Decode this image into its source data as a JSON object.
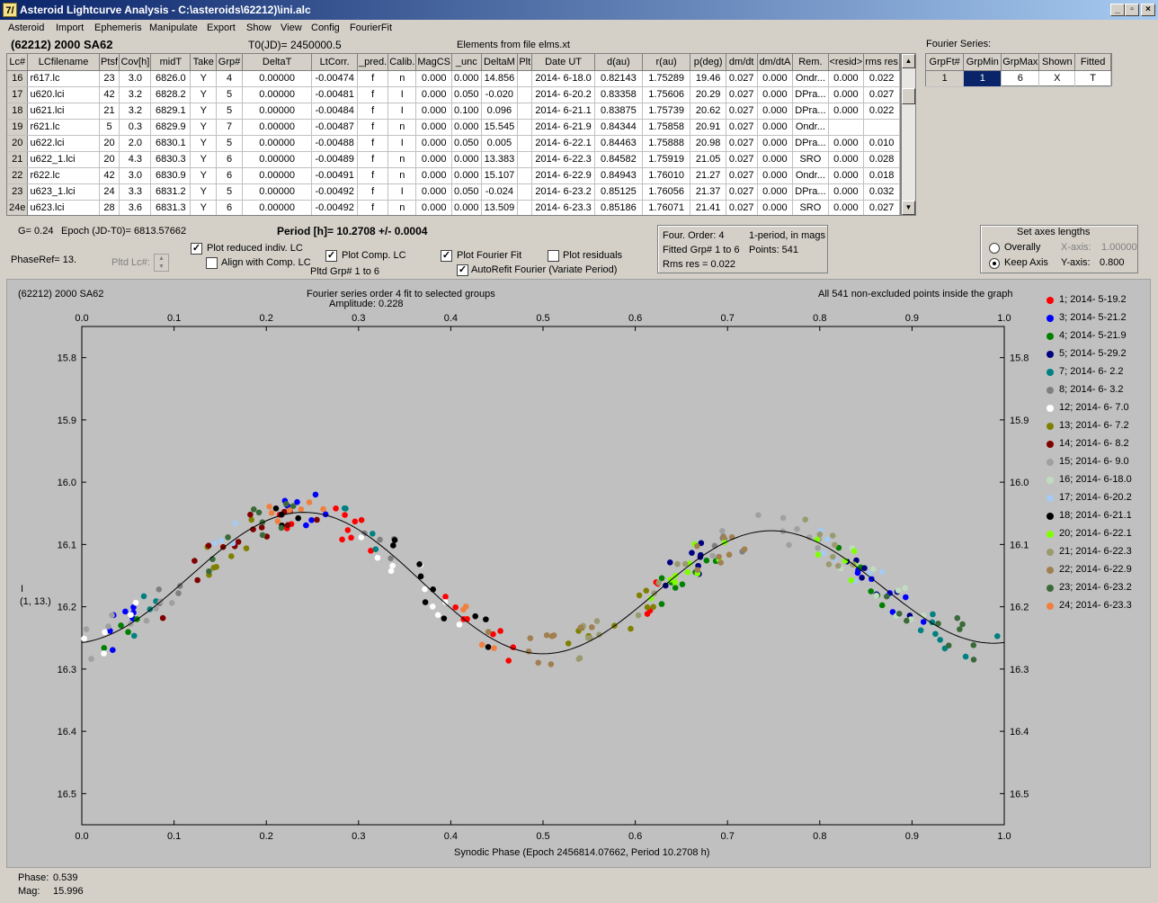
{
  "window": {
    "title": "Asteroid Lightcurve Analysis - C:\\asteroids\\62212)\\ini.alc",
    "icon": "7/",
    "btn_min": "_",
    "btn_max": "▫",
    "btn_close": "×"
  },
  "menu": [
    "Asteroid",
    "Import",
    "Ephemeris",
    "Manipulate",
    "Export",
    "Show",
    "View",
    "Config",
    "FourierFit"
  ],
  "header": {
    "object": "(62212) 2000 SA62",
    "t0": "T0(JD)= 2450000.5",
    "elements": "Elements from file elms.xt",
    "fourier_series_label": "Fourier Series:"
  },
  "lc_table": {
    "columns": [
      "Lc#",
      "LCfilename",
      "Ptsf",
      "Cov[h]",
      "midT",
      "Take",
      "Grp#",
      "DeltaT",
      "LtCorr.",
      "_pred.",
      "Calib.",
      "MagCS",
      "_unc",
      "DeltaM",
      "Plt",
      "Date UT",
      "d(au)",
      "r(au)",
      "p(deg)",
      "dm/dt",
      "dm/dtA",
      "Rem.",
      "<resid>",
      "rms res"
    ],
    "rows": [
      [
        "16",
        "r617.lc",
        "23",
        "3.0",
        "6826.0",
        "Y",
        "4",
        "0.00000",
        "-0.00474",
        "f",
        "n",
        "0.000",
        "0.000",
        "14.856",
        "",
        "2014- 6-18.0",
        "0.82143",
        "1.75289",
        "19.46",
        "0.027",
        "0.000",
        "Ondr...",
        "0.000",
        "0.022"
      ],
      [
        "17",
        "u620.lci",
        "42",
        "3.2",
        "6828.2",
        "Y",
        "5",
        "0.00000",
        "-0.00481",
        "f",
        "I",
        "0.000",
        "0.050",
        "-0.020",
        "",
        "2014- 6-20.2",
        "0.83358",
        "1.75606",
        "20.29",
        "0.027",
        "0.000",
        "DPra...",
        "0.000",
        "0.027"
      ],
      [
        "18",
        "u621.lci",
        "21",
        "3.2",
        "6829.1",
        "Y",
        "5",
        "0.00000",
        "-0.00484",
        "f",
        "I",
        "0.000",
        "0.100",
        "0.096",
        "",
        "2014- 6-21.1",
        "0.83875",
        "1.75739",
        "20.62",
        "0.027",
        "0.000",
        "DPra...",
        "0.000",
        "0.022"
      ],
      [
        "19",
        "r621.lc",
        "5",
        "0.3",
        "6829.9",
        "Y",
        "7",
        "0.00000",
        "-0.00487",
        "f",
        "n",
        "0.000",
        "0.000",
        "15.545",
        "",
        "2014- 6-21.9",
        "0.84344",
        "1.75858",
        "20.91",
        "0.027",
        "0.000",
        "Ondr...",
        "",
        ""
      ],
      [
        "20",
        "u622.lci",
        "20",
        "2.0",
        "6830.1",
        "Y",
        "5",
        "0.00000",
        "-0.00488",
        "f",
        "I",
        "0.000",
        "0.050",
        "0.005",
        "",
        "2014- 6-22.1",
        "0.84463",
        "1.75888",
        "20.98",
        "0.027",
        "0.000",
        "DPra...",
        "0.000",
        "0.010"
      ],
      [
        "21",
        "u622_1.lci",
        "20",
        "4.3",
        "6830.3",
        "Y",
        "6",
        "0.00000",
        "-0.00489",
        "f",
        "n",
        "0.000",
        "0.000",
        "13.383",
        "",
        "2014- 6-22.3",
        "0.84582",
        "1.75919",
        "21.05",
        "0.027",
        "0.000",
        "SRO",
        "0.000",
        "0.028"
      ],
      [
        "22",
        "r622.lc",
        "42",
        "3.0",
        "6830.9",
        "Y",
        "6",
        "0.00000",
        "-0.00491",
        "f",
        "n",
        "0.000",
        "0.000",
        "15.107",
        "",
        "2014- 6-22.9",
        "0.84943",
        "1.76010",
        "21.27",
        "0.027",
        "0.000",
        "Ondr...",
        "0.000",
        "0.018"
      ],
      [
        "23",
        "u623_1.lci",
        "24",
        "3.3",
        "6831.2",
        "Y",
        "5",
        "0.00000",
        "-0.00492",
        "f",
        "I",
        "0.000",
        "0.050",
        "-0.024",
        "",
        "2014- 6-23.2",
        "0.85125",
        "1.76056",
        "21.37",
        "0.027",
        "0.000",
        "DPra...",
        "0.000",
        "0.032"
      ],
      [
        "24e",
        "u623.lci",
        "28",
        "3.6",
        "6831.3",
        "Y",
        "6",
        "0.00000",
        "-0.00492",
        "f",
        "n",
        "0.000",
        "0.000",
        "13.509",
        "",
        "2014- 6-23.3",
        "0.85186",
        "1.76071",
        "21.41",
        "0.027",
        "0.000",
        "SRO",
        "0.000",
        "0.027"
      ]
    ]
  },
  "fourier_table": {
    "columns": [
      "GrpFt#",
      "GrpMin",
      "GrpMax",
      "Shown",
      "Fitted"
    ],
    "row": [
      "1",
      "1",
      "6",
      "X",
      "T"
    ]
  },
  "controls": {
    "g_label": "G= 0.24",
    "epoch_label": "Epoch (JD-T0)= 6813.57662",
    "period_label": "Period [h]= 10.2708 +/- 0.0004",
    "phase_ref": "PhaseRef= 13.",
    "pltd_lc": "Pltd Lc#:",
    "plot_reduced": "Plot reduced indiv. LC",
    "align_comp": "Align with Comp. LC",
    "plot_comp": "Plot Comp. LC",
    "pltd_grp": "Pltd Grp#  1   to   6",
    "plot_fourier": "Plot Fourier Fit",
    "plot_residuals": "Plot residuals",
    "autorefit": "AutoRefit Fourier (Variate Period)",
    "info1": "Four. Order:  4",
    "info2": "1-period, in mags",
    "info3": "Fitted Grp# 1 to 6",
    "info4": "Points: 541",
    "info5": "Rms res     = 0.022",
    "axes_title": "Set axes lengths",
    "overally": "Overally",
    "keep_axis": "Keep Axis",
    "xaxis_label": "X-axis:",
    "xaxis_val": "1.00000",
    "yaxis_label": "Y-axis:",
    "yaxis_val": "0.800"
  },
  "chart_data": {
    "type": "scatter",
    "title": "(62212) 2000 SA62",
    "subtitle": "Fourier series order 4 fit to selected groups",
    "amplitude": "Amplitude: 0.228",
    "note": "All 541 non-excluded points inside the graph",
    "xlabel": "Synodic Phase (Epoch 2456814.07662, Period 10.2708 h)",
    "ylabel": "I",
    "ylabel2": "(1, 13.)",
    "xlim": [
      0,
      1
    ],
    "ylim": [
      16.55,
      15.75
    ],
    "x_ticks": [
      "0.0",
      "0.1",
      "0.2",
      "0.3",
      "0.4",
      "0.5",
      "0.6",
      "0.7",
      "0.8",
      "0.9",
      "1.0"
    ],
    "y_ticks": [
      "15.8",
      "15.9",
      "16.0",
      "16.1",
      "16.2",
      "16.3",
      "16.4",
      "16.5"
    ],
    "grid": false,
    "fourier_fit": {
      "mean": 16.165,
      "terms": [
        [
          -0.009,
          -0.0145
        ],
        [
          0.1015,
          -0.0075
        ],
        [
          0.0,
          0.0
        ],
        [
          0.0,
          0.0
        ]
      ]
    },
    "series": [
      {
        "name": "1; 2014- 5-19.2",
        "color": "#ff0000",
        "ranges": [
          [
            0.2,
            0.33
          ],
          [
            0.38,
            0.47
          ],
          [
            0.6,
            0.63
          ]
        ]
      },
      {
        "name": "3; 2014- 5-21.2",
        "color": "#0000ff",
        "ranges": [
          [
            0.0,
            0.08
          ],
          [
            0.2,
            0.28
          ],
          [
            0.84,
            0.92
          ]
        ]
      },
      {
        "name": "4; 2014- 5-21.9",
        "color": "#008000",
        "ranges": [
          [
            0.01,
            0.06
          ],
          [
            0.62,
            0.72
          ],
          [
            0.82,
            0.88
          ]
        ]
      },
      {
        "name": "5; 2014- 5-29.2",
        "color": "#000080",
        "ranges": [
          [
            0.61,
            0.7
          ],
          [
            0.82,
            0.9
          ]
        ]
      },
      {
        "name": "7; 2014- 6- 2.2",
        "color": "#008080",
        "ranges": [
          [
            0.05,
            0.1
          ],
          [
            0.28,
            0.33
          ],
          [
            0.9,
            1.0
          ]
        ]
      },
      {
        "name": "8; 2014- 6- 3.2",
        "color": "#808080",
        "ranges": [
          [
            0.07,
            0.12
          ],
          [
            0.3,
            0.35
          ],
          [
            0.66,
            0.72
          ]
        ]
      },
      {
        "name": "12; 2014- 6- 7.0",
        "color": "#ffffff",
        "ranges": [
          [
            0.0,
            0.06
          ],
          [
            0.3,
            0.42
          ]
        ]
      },
      {
        "name": "13; 2014- 6- 7.2",
        "color": "#808000",
        "ranges": [
          [
            0.12,
            0.2
          ],
          [
            0.52,
            0.64
          ]
        ]
      },
      {
        "name": "14; 2014- 6- 8.2",
        "color": "#800000",
        "ranges": [
          [
            0.08,
            0.26
          ]
        ]
      },
      {
        "name": "15; 2014- 6- 9.0",
        "color": "#a0a0a0",
        "ranges": [
          [
            0.0,
            0.1
          ],
          [
            0.68,
            0.8
          ]
        ]
      },
      {
        "name": "16; 2014- 6-18.0",
        "color": "#c0dcc0",
        "ranges": [
          [
            0.82,
            0.92
          ]
        ]
      },
      {
        "name": "17; 2014- 6-20.2",
        "color": "#a6caf0",
        "ranges": [
          [
            0.14,
            0.18
          ],
          [
            0.8,
            0.88
          ]
        ]
      },
      {
        "name": "18; 2014- 6-21.1",
        "color": "#000000",
        "ranges": [
          [
            0.21,
            0.24
          ],
          [
            0.33,
            0.45
          ]
        ]
      },
      {
        "name": "20; 2014- 6-22.1",
        "color": "#80ff00",
        "ranges": [
          [
            0.6,
            0.72
          ],
          [
            0.77,
            0.84
          ]
        ]
      },
      {
        "name": "21; 2014- 6-22.3",
        "color": "#9a9a70",
        "ranges": [
          [
            0.52,
            0.66
          ],
          [
            0.74,
            0.84
          ]
        ]
      },
      {
        "name": "22; 2014- 6-22.9",
        "color": "#a08050",
        "ranges": [
          [
            0.44,
            0.56
          ],
          [
            0.66,
            0.76
          ]
        ]
      },
      {
        "name": "23; 2014- 6-23.2",
        "color": "#3a6a3a",
        "ranges": [
          [
            0.12,
            0.24
          ],
          [
            0.86,
            0.98
          ]
        ]
      },
      {
        "name": "24; 2014- 6-23.3",
        "color": "#f08040",
        "ranges": [
          [
            0.19,
            0.27
          ],
          [
            0.4,
            0.45
          ]
        ]
      }
    ]
  },
  "status": {
    "phase_label": "Phase:",
    "phase_val": "0.539",
    "mag_label": "Mag:",
    "mag_val": "15.996"
  }
}
